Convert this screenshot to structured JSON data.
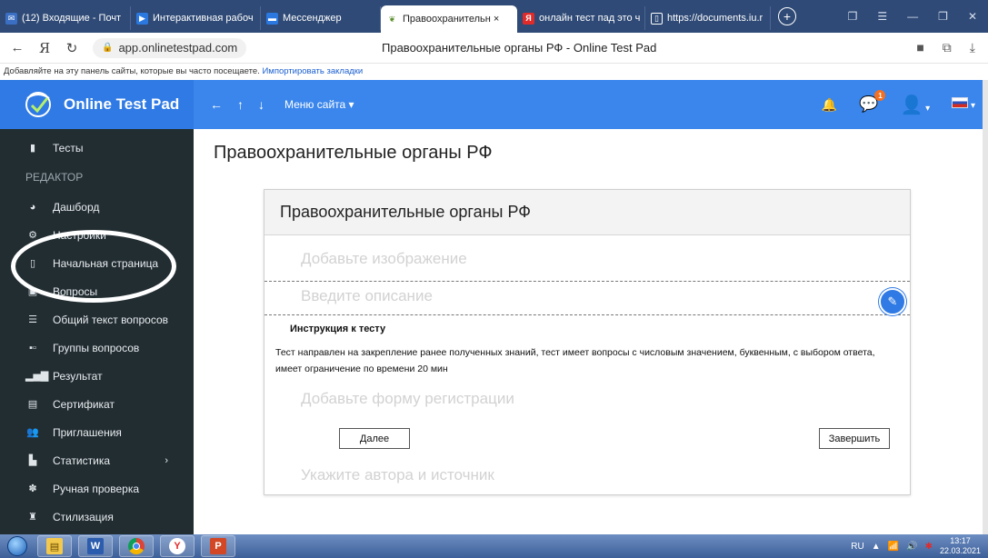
{
  "browser": {
    "tabs": [
      {
        "label": "(12) Входящие - Почт",
        "icon": "mail-icon",
        "color": "#3b6fc4"
      },
      {
        "label": "Интерактивная рабоч",
        "icon": "presentation-icon",
        "color": "#2b79e0"
      },
      {
        "label": "Мессенджер",
        "icon": "messenger-icon",
        "color": "#2b79e0"
      },
      {
        "label": "Правоохранительн ×",
        "icon": "onlinetestpad-icon",
        "color": "#ffffff",
        "active": true
      },
      {
        "label": "онлайн тест пад это ч",
        "icon": "yandex-icon",
        "color": "#e02b2b"
      },
      {
        "label": "https://documents.iu.r",
        "icon": "document-icon",
        "color": "#ffffff"
      }
    ],
    "url": "app.onlinetestpad.com",
    "page_title": "Правоохранительные органы РФ - Online Test Pad",
    "bookmarks_text": "Добавляйте на эту панель сайты, которые вы часто посещаете.",
    "bookmarks_link": "Импортировать закладки"
  },
  "site": {
    "logo_text": "Online Test Pad",
    "menu_label": "Меню сайта",
    "notification_count": "1",
    "brand_color": "#3a86ec"
  },
  "sidebar": {
    "items": [
      {
        "label": "Тесты",
        "icon": "test-icon"
      },
      {
        "label": "РЕДАКТОР",
        "section": true
      },
      {
        "label": "Дашборд",
        "icon": "dashboard-icon"
      },
      {
        "label": "Настройки",
        "icon": "gear-icon"
      },
      {
        "label": "Начальная страница",
        "icon": "page-icon",
        "highlight": true
      },
      {
        "label": "Вопросы",
        "icon": "question-icon"
      },
      {
        "label": "Общий текст вопросов",
        "icon": "text-icon"
      },
      {
        "label": "Группы вопросов",
        "icon": "groups-icon"
      },
      {
        "label": "Результат",
        "icon": "result-icon"
      },
      {
        "label": "Сертификат",
        "icon": "certificate-icon"
      },
      {
        "label": "Приглашения",
        "icon": "invite-icon"
      },
      {
        "label": "Статистика",
        "icon": "stats-icon",
        "arrow": true
      },
      {
        "label": "Ручная проверка",
        "icon": "check-icon"
      },
      {
        "label": "Стилизация",
        "icon": "style-icon"
      }
    ]
  },
  "main": {
    "title": "Правоохранительные органы РФ",
    "card_title": "Правоохранительные органы РФ",
    "add_image": "Добавьте изображение",
    "description_placeholder": "Введите описание",
    "instruction_title": "Инструкция к тесту",
    "instruction_text": "Тест направлен на закрепление ранее полученных знаний, тест имеет вопросы с числовым значением, буквенным, с выбором ответа, имеет ограничение по времени 20 мин",
    "add_registration": "Добавьте форму регистрации",
    "next_button": "Далее",
    "finish_button": "Завершить",
    "author_placeholder": "Укажите автора и источник"
  },
  "taskbar": {
    "apps": [
      "explorer-icon",
      "word-icon",
      "chrome-icon",
      "yandex-browser-icon",
      "powerpoint-icon"
    ],
    "lang": "RU",
    "time": "13:17",
    "date": "22.03.2021"
  }
}
